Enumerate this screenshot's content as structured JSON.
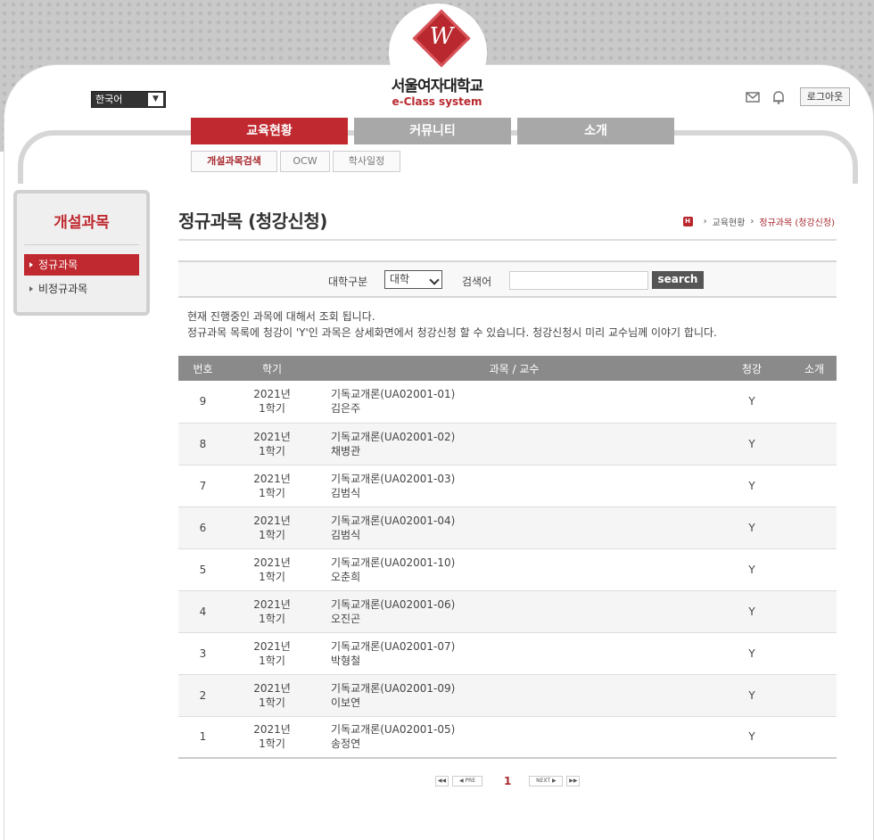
{
  "header": {
    "language": "한국어",
    "logo_name": "서울여자대학교",
    "logo_sub": "e-Class system",
    "logout_label": "로그아웃"
  },
  "gnb": {
    "tabs": [
      {
        "label": "교육현황"
      },
      {
        "label": "커뮤니티"
      },
      {
        "label": "소개"
      }
    ],
    "subtabs": [
      {
        "label": "개설과목검색"
      },
      {
        "label": "OCW"
      },
      {
        "label": "학사일정"
      }
    ]
  },
  "lnb": {
    "title": "개설과목",
    "items": [
      {
        "label": "정규과목"
      },
      {
        "label": "비정규과목"
      }
    ]
  },
  "page": {
    "title": "정규과목 (청강신청)",
    "breadcrumb": [
      "교육현황",
      "정규과목 (청강신청)"
    ]
  },
  "search": {
    "label1": "대학구분",
    "select_value": "대학",
    "label2": "검색어",
    "input_value": "",
    "button_label": "search"
  },
  "notice": {
    "line1": "현재 진행중인 과목에 대해서 조회 됩니다.",
    "line2": "정규과목 목록에 청강이 'Y'인 과목은 상세화면에서 청강신청 할 수 있습니다. 청강신청시 미리 교수님께 이야기 합니다."
  },
  "table": {
    "headers": [
      "번호",
      "학기",
      "과목 / 교수",
      "청강",
      "소개"
    ],
    "rows": [
      {
        "no": "9",
        "year": "2021년",
        "term": "1학기",
        "course": "기독교개론(UA02001-01)",
        "prof": "김은주",
        "audit": "Y"
      },
      {
        "no": "8",
        "year": "2021년",
        "term": "1학기",
        "course": "기독교개론(UA02001-02)",
        "prof": "채병관",
        "audit": "Y"
      },
      {
        "no": "7",
        "year": "2021년",
        "term": "1학기",
        "course": "기독교개론(UA02001-03)",
        "prof": "김범식",
        "audit": "Y"
      },
      {
        "no": "6",
        "year": "2021년",
        "term": "1학기",
        "course": "기독교개론(UA02001-04)",
        "prof": "김범식",
        "audit": "Y"
      },
      {
        "no": "5",
        "year": "2021년",
        "term": "1학기",
        "course": "기독교개론(UA02001-10)",
        "prof": "오춘희",
        "audit": "Y"
      },
      {
        "no": "4",
        "year": "2021년",
        "term": "1학기",
        "course": "기독교개론(UA02001-06)",
        "prof": "오진곤",
        "audit": "Y"
      },
      {
        "no": "3",
        "year": "2021년",
        "term": "1학기",
        "course": "기독교개론(UA02001-07)",
        "prof": "박형철",
        "audit": "Y"
      },
      {
        "no": "2",
        "year": "2021년",
        "term": "1학기",
        "course": "기독교개론(UA02001-09)",
        "prof": "이보연",
        "audit": "Y"
      },
      {
        "no": "1",
        "year": "2021년",
        "term": "1학기",
        "course": "기독교개론(UA02001-05)",
        "prof": "송정연",
        "audit": "Y"
      }
    ]
  },
  "pager": {
    "prev_label": "PRE",
    "current_page": "1",
    "next_label": "NEXT"
  },
  "colors": {
    "accent": "#c0292f",
    "tab_inactive": "#a8a8a8",
    "table_header": "#8a8a8a"
  }
}
